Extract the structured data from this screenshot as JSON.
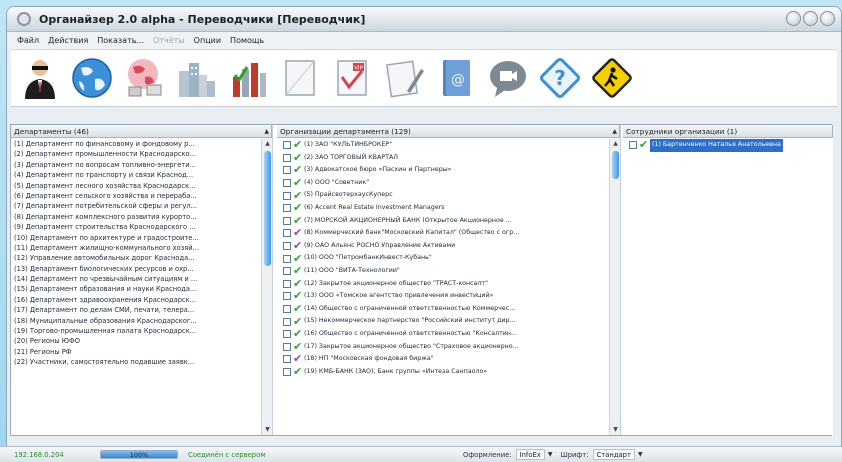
{
  "window": {
    "title": "Органайзер 2.0 alpha - Переводчики [Переводчик]"
  },
  "menu": [
    {
      "label": "Файл",
      "disabled": false
    },
    {
      "label": "Действия",
      "disabled": false
    },
    {
      "label": "Показать...",
      "disabled": false
    },
    {
      "label": "Отчёты",
      "disabled": true
    },
    {
      "label": "Опции",
      "disabled": false
    },
    {
      "label": "Помощь",
      "disabled": false
    }
  ],
  "toolbar": [
    {
      "icon": "user-agent-icon"
    },
    {
      "icon": "globe-icon"
    },
    {
      "icon": "network-globe-icon"
    },
    {
      "icon": "city-buildings-icon"
    },
    {
      "icon": "bar-chart-check-icon"
    },
    {
      "icon": "blank-document-icon"
    },
    {
      "icon": "vip-document-icon"
    },
    {
      "icon": "pen-document-icon"
    },
    {
      "icon": "address-book-icon"
    },
    {
      "icon": "video-chat-icon"
    },
    {
      "icon": "help-icon"
    },
    {
      "icon": "pedestrian-sign-icon"
    }
  ],
  "departments": {
    "header": "Департаменты (46)",
    "items": [
      "(1)  Департамент по финансовому и фондовому р...",
      "(2)  Департамент промышленности Краснодарско...",
      "(3)  Департамент по вопросам топливно-энергети...",
      "(4)  Департамент по транспорту и связи Краснод...",
      "(5)  Департамент лесного хозяйства Краснодарск...",
      "(6)  Департамент сельского хозяйства и перераба...",
      "(7)  Департамент потребительской сферы и регул...",
      "(8)  Департамент комплексного развития курорто...",
      "(9)  Департамент строительства Краснодарского ...",
      "(10)  Департамент по архитектуре и градостроите...",
      "(11)  Департамент жилищно-коммунального хозяй...",
      "(12)  Управление автомобильных дорог Краснода...",
      "(13)  Департамент биологических ресурсов и охр...",
      "(14)  Департамент по чрезвычайным ситуациям и ...",
      "(15)  Департамент образования и науки Краснода...",
      "(16)  Департамент здравоохранения Краснодарск...",
      "(17)  Департамент по делам СМИ, печати, телера...",
      "(18)  Муниципальные образования Краснодарског...",
      "(19)  Торгово-промышленная палата Краснодарск...",
      "(20)  Регионы ЮФО",
      "(21)  Регионы РФ",
      "(22)  Участники, самостоятельно подавшие заявк..."
    ]
  },
  "organizations": {
    "header": "Организации департамента (129)",
    "items": [
      {
        "text": "(1) ЗАО \"КУЛЬТИНБРОКЕР\"",
        "mark": "green"
      },
      {
        "text": "(2) ЗАО ТОРГОВЫЙ КВАРТАЛ",
        "mark": "green"
      },
      {
        "text": "(3) Адвокатское бюро «Пасхин и Партнеры»",
        "mark": "green"
      },
      {
        "text": "(4) ООО \"Советник\"",
        "mark": "green"
      },
      {
        "text": "(5) ПрайсвотерхаусКуперс",
        "mark": "green"
      },
      {
        "text": "(6) Accent Real Estate Investment Managers",
        "mark": "green"
      },
      {
        "text": "(7) МОРСКОЙ АКЦИОНЕРНЫЙ БАНК (Открытое Акционерное ...",
        "mark": "green"
      },
      {
        "text": "(8) Коммерческий банк\"Московский Капитал\" (Общество с огр...",
        "mark": "purple"
      },
      {
        "text": "(9) ОАО Альянс РОСНО Управление Активами",
        "mark": "purple"
      },
      {
        "text": "(10) ООО \"ПетромбанкИнвест-Кубань\"",
        "mark": "green"
      },
      {
        "text": "(11) ООО \"ВИТА-Технологии\"",
        "mark": "green"
      },
      {
        "text": "(12) Закрытое акционерное общество \"ТРАСТ-консалт\"",
        "mark": "green"
      },
      {
        "text": "(13) ООО «Томское агентство привлечения инвестиций»",
        "mark": "green"
      },
      {
        "text": "(14) Общество с ограниченной ответственностью Коммерчес...",
        "mark": "green"
      },
      {
        "text": "(15) Некоммерческое партнерство \"Российский институт дир...",
        "mark": "green"
      },
      {
        "text": "(16) Общество с ограниченной ответственностью \"Консалтин...",
        "mark": "green"
      },
      {
        "text": "(17) Закрытое акционерное общество \"Страховое акционерно...",
        "mark": "green"
      },
      {
        "text": "(18) НП \"Московская фондовая биржа\"",
        "mark": "purple"
      },
      {
        "text": "(19) КМБ-БАНК (ЗАО), Банк группы «Интеза Санпаоло»",
        "mark": "green"
      }
    ]
  },
  "employees": {
    "header": "Сотрудники организации (1)",
    "items": [
      {
        "text": "(1) Бартенченко Наталья Анатольевна",
        "mark": "green"
      }
    ]
  },
  "statusbar": {
    "ip": "192.168.0.204",
    "progress_text": "100%",
    "progress": 1.0,
    "connection": "Соединён с сервером",
    "skin_label": "Оформление:",
    "skin_value": "InfoEx",
    "font_label": "Шрифт:",
    "font_value": "Стандарт"
  },
  "colors": {
    "check_green": "#2fa52f",
    "check_purple": "#9b3fc6",
    "selection": "#2d6fc8",
    "status_green": "#2c8a2c"
  }
}
